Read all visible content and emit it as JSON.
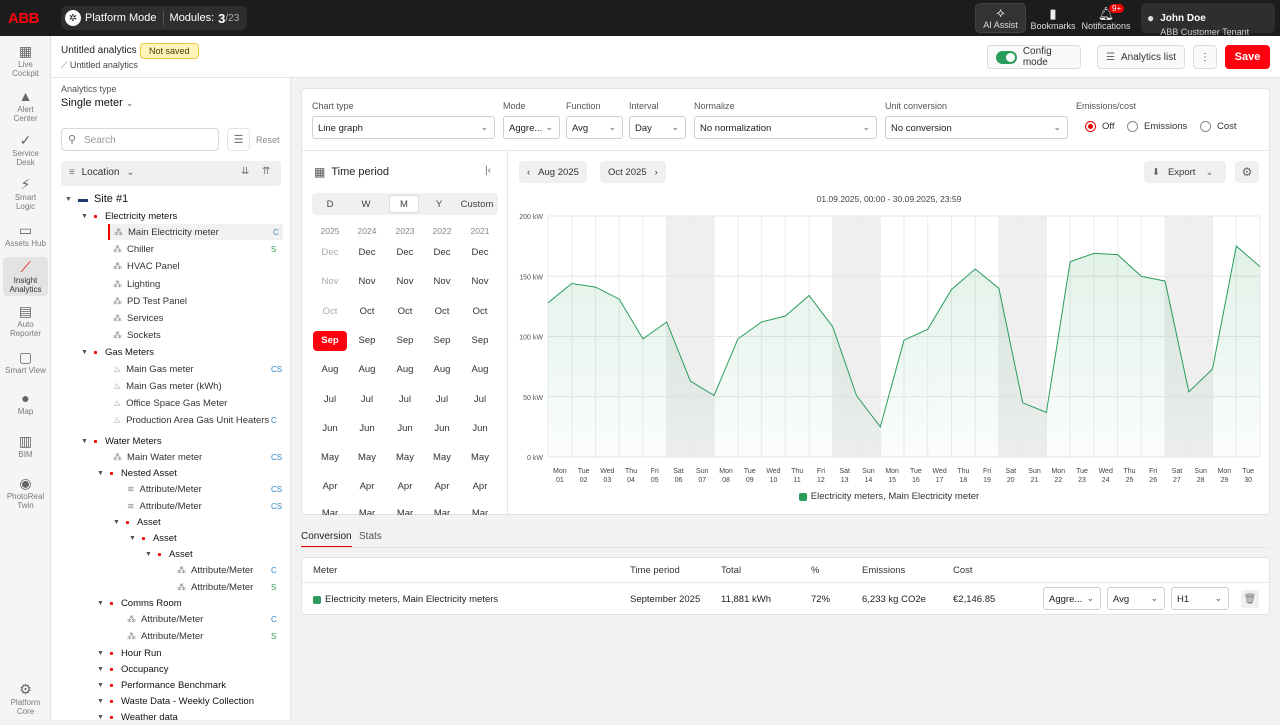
{
  "topbar": {
    "logo": "ABB",
    "platform_label": "Platform Mode",
    "modules_label": "Modules:",
    "modules_active": "3",
    "modules_total": "/23",
    "ai_assist": "AI Assist",
    "bookmarks": "Bookmarks",
    "notifications": "Notifications",
    "notifications_badge": "9+",
    "user_name": "John Doe",
    "user_tenant": "ABB Customer Tenant"
  },
  "sidebar": [
    {
      "l1": "Live",
      "l2": "Cockpit",
      "icon": "grid-icon"
    },
    {
      "l1": "Alert",
      "l2": "Center",
      "icon": "alert-icon"
    },
    {
      "l1": "Service",
      "l2": "Desk",
      "icon": "wrench-icon"
    },
    {
      "l1": "Smart",
      "l2": "Logic",
      "icon": "bolt-icon"
    },
    {
      "l1": "Assets Hub",
      "l2": "",
      "icon": "monitor-icon"
    },
    {
      "l1": "Insight",
      "l2": "Analytics",
      "icon": "chart-icon"
    },
    {
      "l1": "Auto",
      "l2": "Reporter",
      "icon": "document-icon"
    },
    {
      "l1": "Smart View",
      "l2": "",
      "icon": "screen-icon"
    },
    {
      "l1": "Map",
      "l2": "",
      "icon": "map-pin-icon"
    },
    {
      "l1": "BIM",
      "l2": "",
      "icon": "building-icon"
    },
    {
      "l1": "PhotoReal",
      "l2": "Twin",
      "icon": "camera-icon"
    },
    {
      "l1": "Platform",
      "l2": "Core",
      "icon": "chip-icon"
    }
  ],
  "header": {
    "title": "Untitled analytics",
    "badge": "Not saved",
    "breadcrumb": "Untitled analytics",
    "config_mode": "Config mode",
    "analytics_list": "Analytics list",
    "save": "Save"
  },
  "left": {
    "analytics_type_label": "Analytics type",
    "analytics_type": "Single meter",
    "search_placeholder": "Search",
    "reset": "Reset",
    "location": "Location"
  },
  "tree": [
    {
      "label": "Site #1",
      "d": 0,
      "k": "site"
    },
    {
      "label": "Electricity meters",
      "d": 1,
      "k": "group"
    },
    {
      "label": "Main Electricity meter",
      "d": 2,
      "k": "elec",
      "tag": "C",
      "sel": true
    },
    {
      "label": "Chiller",
      "d": 2,
      "k": "elec",
      "tag": "S"
    },
    {
      "label": "HVAC Panel",
      "d": 2,
      "k": "elec"
    },
    {
      "label": "Lighting",
      "d": 2,
      "k": "elec"
    },
    {
      "label": "PD Test Panel",
      "d": 2,
      "k": "elec"
    },
    {
      "label": "Services",
      "d": 2,
      "k": "elec"
    },
    {
      "label": "Sockets",
      "d": 2,
      "k": "elec"
    },
    {
      "label": "Gas Meters",
      "d": 1,
      "k": "group"
    },
    {
      "label": "Main Gas meter",
      "d": 2,
      "k": "gas",
      "tag": "CS"
    },
    {
      "label": "Main Gas meter (kWh)",
      "d": 2,
      "k": "gas"
    },
    {
      "label": "Office Space Gas Meter",
      "d": 2,
      "k": "gas"
    },
    {
      "label": "Production Area Gas Unit Heaters",
      "d": 2,
      "k": "gas",
      "tag": "C"
    },
    {
      "label": "Water Meters",
      "d": 1,
      "k": "group"
    },
    {
      "label": "Main Water meter",
      "d": 2,
      "k": "water",
      "tag": "CS"
    },
    {
      "label": "Nested Asset",
      "d": 2,
      "k": "group"
    },
    {
      "label": "Attribute/Meter",
      "d": 3,
      "k": "wifi",
      "tag": "CS"
    },
    {
      "label": "Attribute/Meter",
      "d": 3,
      "k": "wifi",
      "tag": "CS"
    },
    {
      "label": "Asset",
      "d": 3,
      "k": "group"
    },
    {
      "label": "Asset",
      "d": 4,
      "k": "group"
    },
    {
      "label": "Asset",
      "d": 5,
      "k": "group"
    },
    {
      "label": "Attribute/Meter",
      "d": 6,
      "k": "elec",
      "tag": "C"
    },
    {
      "label": "Attribute/Meter",
      "d": 6,
      "k": "elec",
      "tag": "S"
    },
    {
      "label": "Comms Room",
      "d": 2,
      "k": "group"
    },
    {
      "label": "Attribute/Meter",
      "d": 3,
      "k": "elec",
      "tag": "C"
    },
    {
      "label": "Attribute/Meter",
      "d": 3,
      "k": "elec",
      "tag": "S"
    },
    {
      "label": "Hour Run",
      "d": 2,
      "k": "group"
    },
    {
      "label": "Occupancy",
      "d": 2,
      "k": "group"
    },
    {
      "label": "Performance Benchmark",
      "d": 2,
      "k": "group"
    },
    {
      "label": "Waste Data - Weekly Collection",
      "d": 2,
      "k": "group"
    },
    {
      "label": "Weather data",
      "d": 2,
      "k": "group"
    }
  ],
  "controls": {
    "chart_type_label": "Chart type",
    "chart_type": "Line graph",
    "mode_label": "Mode",
    "mode": "Aggre...",
    "function_label": "Function",
    "function": "Avg",
    "interval_label": "Interval",
    "interval": "Day",
    "normalize_label": "Normalize",
    "normalize": "No normalization",
    "unit_label": "Unit conversion",
    "unit": "No conversion",
    "emissions_label": "Emissions/cost",
    "opt_off": "Off",
    "opt_emissions": "Emissions",
    "opt_cost": "Cost",
    "selected": "Off"
  },
  "time_period": {
    "title": "Time period",
    "tabs": [
      "D",
      "W",
      "M",
      "Y",
      "Custom"
    ],
    "active_tab": "M",
    "years": [
      "2025",
      "2024",
      "2023",
      "2022",
      "2021"
    ],
    "months": [
      "Dec",
      "Nov",
      "Oct",
      "Sep",
      "Aug",
      "Jul",
      "Jun",
      "May",
      "Apr",
      "Mar"
    ],
    "disabled_2025": [
      "Dec",
      "Nov",
      "Oct"
    ],
    "selected": {
      "year": "2025",
      "month": "Sep"
    }
  },
  "chart_nav": {
    "prev": "Aug 2025",
    "next": "Oct 2025",
    "export": "Export",
    "range": "01.09.2025, 00:00 - 30.09.2025, 23:59"
  },
  "chart_data": {
    "type": "area",
    "title": "",
    "ylim": [
      0,
      200
    ],
    "yticks": [
      "0 kW",
      "50 kW",
      "100 kW",
      "150 kW",
      "200 kW"
    ],
    "x_days": [
      "Mon",
      "Tue",
      "Wed",
      "Thu",
      "Fri",
      "Sat",
      "Sun",
      "Mon",
      "Tue",
      "Wed",
      "Thu",
      "Fri",
      "Sat",
      "Sun",
      "Mon",
      "Tue",
      "Wed",
      "Thu",
      "Fri",
      "Sat",
      "Sun",
      "Mon",
      "Tue",
      "Wed",
      "Thu",
      "Fri",
      "Sat",
      "Sun",
      "Mon",
      "Tue"
    ],
    "x_dates": [
      "01",
      "02",
      "03",
      "04",
      "05",
      "06",
      "07",
      "08",
      "09",
      "10",
      "11",
      "12",
      "13",
      "14",
      "15",
      "16",
      "17",
      "18",
      "19",
      "20",
      "21",
      "22",
      "23",
      "24",
      "25",
      "26",
      "27",
      "28",
      "29",
      "30"
    ],
    "weekend_days": [
      "06",
      "07",
      "13",
      "14",
      "20",
      "21",
      "27",
      "28"
    ],
    "series": [
      {
        "name": "Electricity meters, Main Electricity meter",
        "color": "#2a9d5c",
        "values": [
          128,
          144,
          141,
          131,
          98,
          112,
          63,
          51,
          98,
          112,
          117,
          134,
          108,
          51,
          25,
          97,
          106,
          139,
          156,
          140,
          45,
          37,
          162,
          169,
          168,
          150,
          146,
          54,
          73,
          175,
          158
        ]
      }
    ],
    "grid": true,
    "legend": "bottom"
  },
  "tabs": {
    "conversion": "Conversion",
    "stats": "Stats",
    "active": "Conversion"
  },
  "table": {
    "headers": {
      "meter": "Meter",
      "period": "Time period",
      "total": "Total",
      "pct": "%",
      "emissions": "Emissions",
      "cost": "Cost"
    },
    "row": {
      "meter": "Electricity meters, Main Electricity meters",
      "period": "September 2025",
      "total": "11,881 kWh",
      "pct": "72%",
      "emissions": "6,233 kg CO2e",
      "cost": "€2,146.85",
      "mode": "Aggre...",
      "func": "Avg",
      "slot": "H1"
    }
  },
  "colors": {
    "accent": "#ff000f",
    "series": "#2a9d5c",
    "topbar": "#1c1c1c"
  }
}
